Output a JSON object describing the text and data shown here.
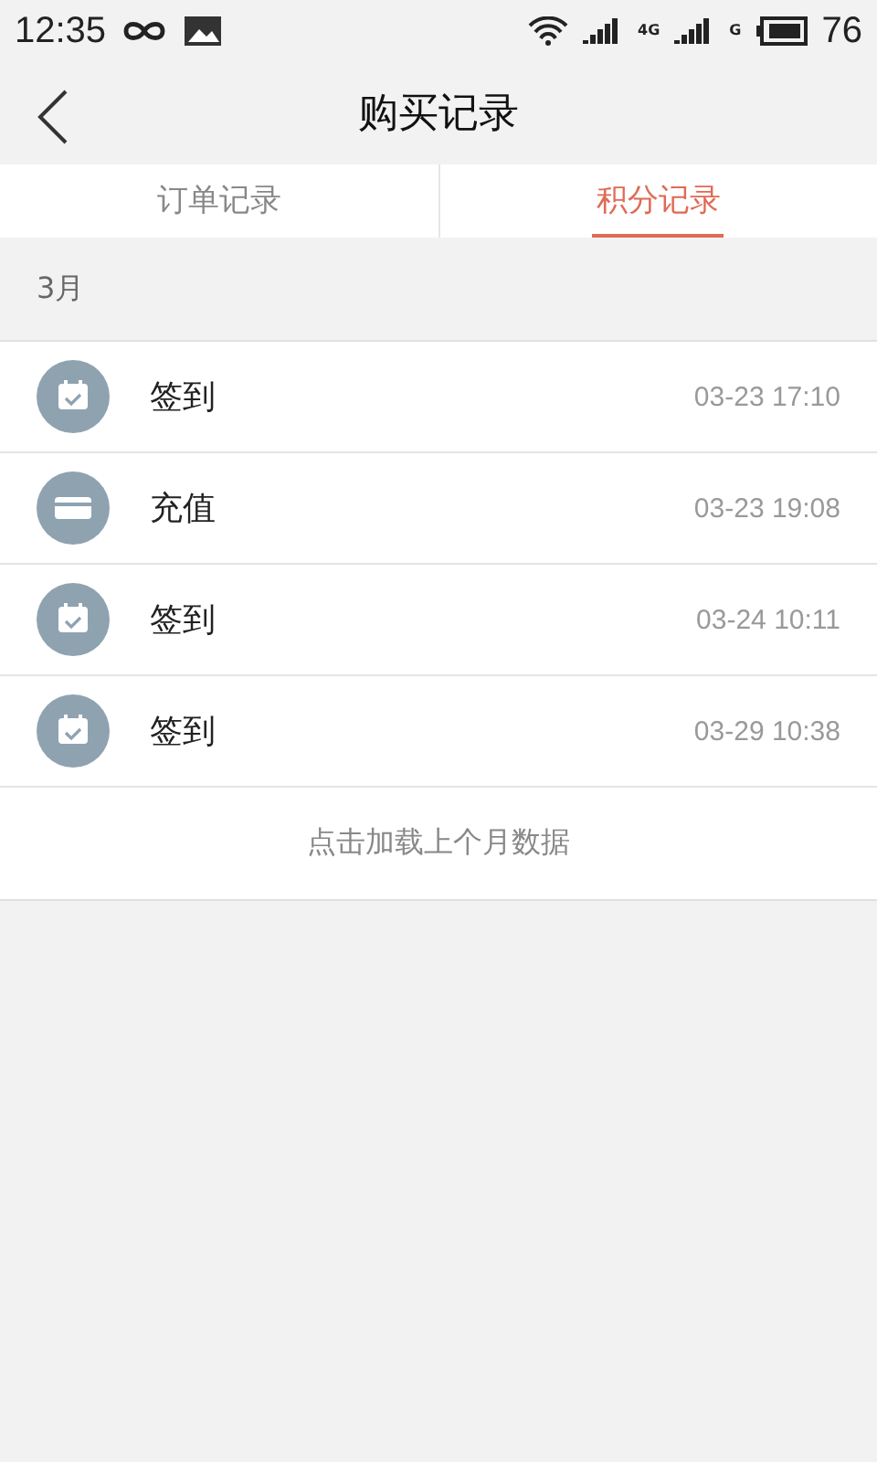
{
  "status_bar": {
    "time": "12:35",
    "network_labels": [
      "4G",
      "G"
    ],
    "battery": "76"
  },
  "header": {
    "title": "购买记录"
  },
  "tabs": [
    {
      "label": "订单记录",
      "selected": false
    },
    {
      "label": "积分记录",
      "selected": true
    }
  ],
  "month": "3月",
  "records": [
    {
      "kind": "checkin",
      "title": "签到",
      "time": "03-23 17:10"
    },
    {
      "kind": "recharge",
      "title": "充值",
      "time": "03-23 19:08"
    },
    {
      "kind": "checkin",
      "title": "签到",
      "time": "03-24 10:11"
    },
    {
      "kind": "checkin",
      "title": "签到",
      "time": "03-29 10:38"
    }
  ],
  "load_more": "点击加载上个月数据"
}
